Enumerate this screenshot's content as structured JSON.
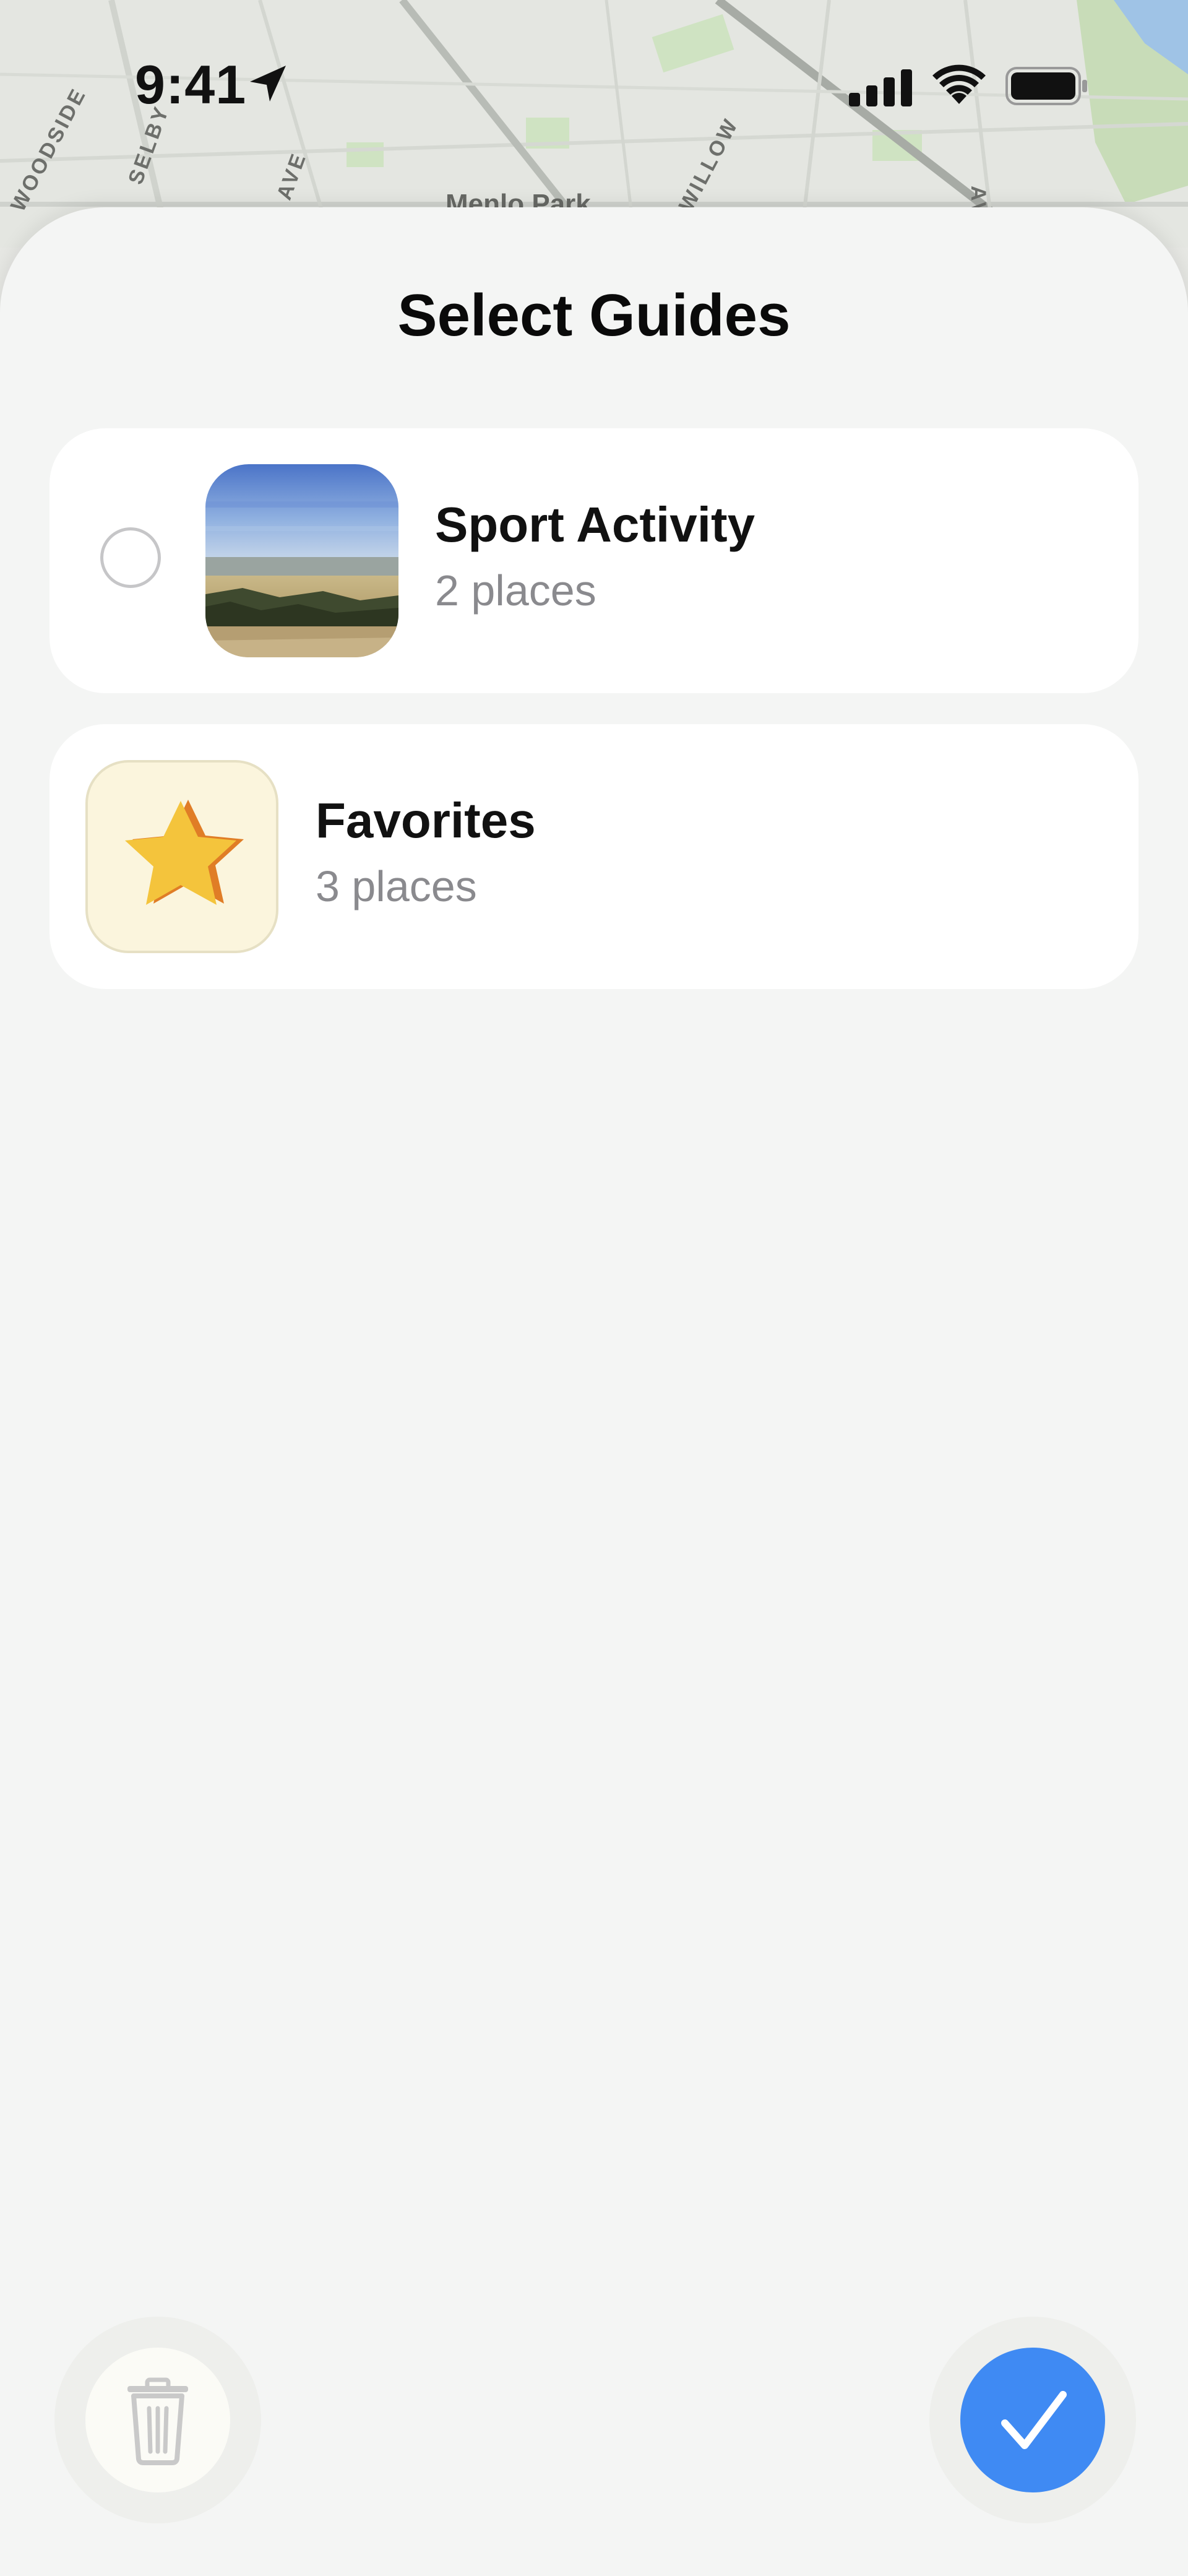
{
  "status_bar": {
    "time": "9:41",
    "icons": [
      "location-arrow-icon",
      "cellular-signal-icon",
      "wifi-icon",
      "battery-icon"
    ]
  },
  "map": {
    "labels": [
      "WOODSIDE",
      "SELBY",
      "AVE",
      "Menlo Park",
      "WILLOW",
      "AVE"
    ]
  },
  "sheet": {
    "title": "Select Guides"
  },
  "guides": [
    {
      "title": "Sport Activity",
      "subtitle": "2 places",
      "selected": false,
      "thumbnail": "landscape-photo"
    },
    {
      "title": "Favorites",
      "subtitle": "3 places",
      "thumbnail": "star-icon"
    }
  ],
  "actions": {
    "delete_icon": "trash-icon",
    "confirm_icon": "checkmark-icon"
  },
  "colors": {
    "accent": "#3f8af3",
    "sheet_background": "#f4f5f4",
    "card_background": "#ffffff",
    "secondary_text": "#8a8a8e",
    "star": "#f4c43c"
  }
}
